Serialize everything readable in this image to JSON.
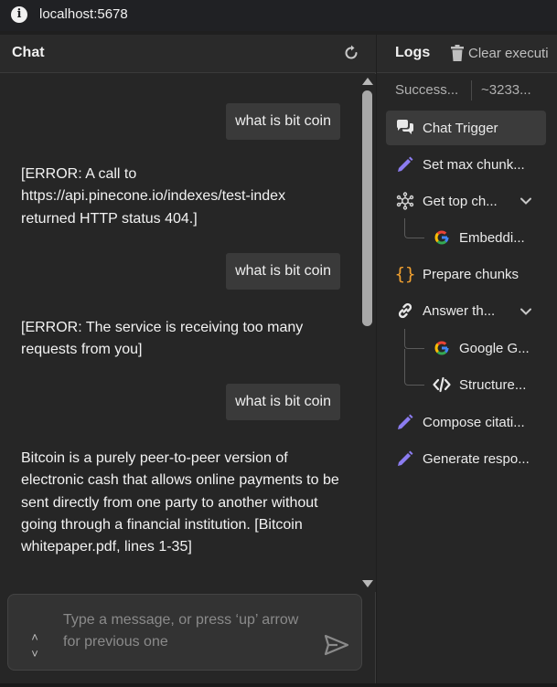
{
  "browser": {
    "url": "localhost:5678"
  },
  "chat": {
    "title": "Chat",
    "messages": [
      {
        "role": "user",
        "text": "what is bit coin"
      },
      {
        "role": "bot",
        "text": "[ERROR: A call to https://api.pinecone.io/indexes/test-index returned HTTP status 404.]"
      },
      {
        "role": "user",
        "text": "what is bit coin"
      },
      {
        "role": "bot",
        "text": "[ERROR: The service is receiving too many requests from you]"
      },
      {
        "role": "user",
        "text": "what is bit coin"
      },
      {
        "role": "bot",
        "text": "Bitcoin is a purely peer-to-peer version of electronic cash that allows online payments to be sent directly from one party to another without going through a financial institution. [Bitcoin whitepaper.pdf, lines 1-35]"
      }
    ],
    "input": {
      "placeholder": "Type a message, or press ‘up’ arrow for previous one",
      "value": ""
    },
    "history_arrows": {
      "up": "˄",
      "down": "˅"
    }
  },
  "logs": {
    "title": "Logs",
    "clear_label": "Clear executi",
    "summary_status": "Success...",
    "summary_time": "~3233...",
    "items": [
      {
        "label": "Chat Trigger",
        "icon": "chat-bubbles-icon",
        "level": 0,
        "active": true
      },
      {
        "label": "Set max chunk...",
        "icon": "pencil-icon",
        "level": 0
      },
      {
        "label": "Get top ch...",
        "icon": "vector-store-icon",
        "level": 0,
        "expandable": true
      },
      {
        "label": "Embeddi...",
        "icon": "google-icon",
        "level": 1
      },
      {
        "label": "Prepare chunks",
        "icon": "code-braces-icon",
        "level": 0
      },
      {
        "label": "Answer th...",
        "icon": "link-chain-icon",
        "level": 0,
        "expandable": true
      },
      {
        "label": "Google G...",
        "icon": "google-icon",
        "level": 1
      },
      {
        "label": "Structure...",
        "icon": "code-tag-icon",
        "level": 1
      },
      {
        "label": "Compose citati...",
        "icon": "pencil-icon",
        "level": 0
      },
      {
        "label": "Generate respo...",
        "icon": "pencil-icon",
        "level": 0
      }
    ]
  },
  "colors": {
    "panel_bg": "#262626",
    "bubble_bg": "#3a3a3a",
    "pencil_purple": "#8b7cf0",
    "braces_orange": "#f0a030",
    "google_blue": "#4285f4",
    "google_red": "#ea4335",
    "google_yellow": "#fbbc05",
    "google_green": "#34a853"
  }
}
